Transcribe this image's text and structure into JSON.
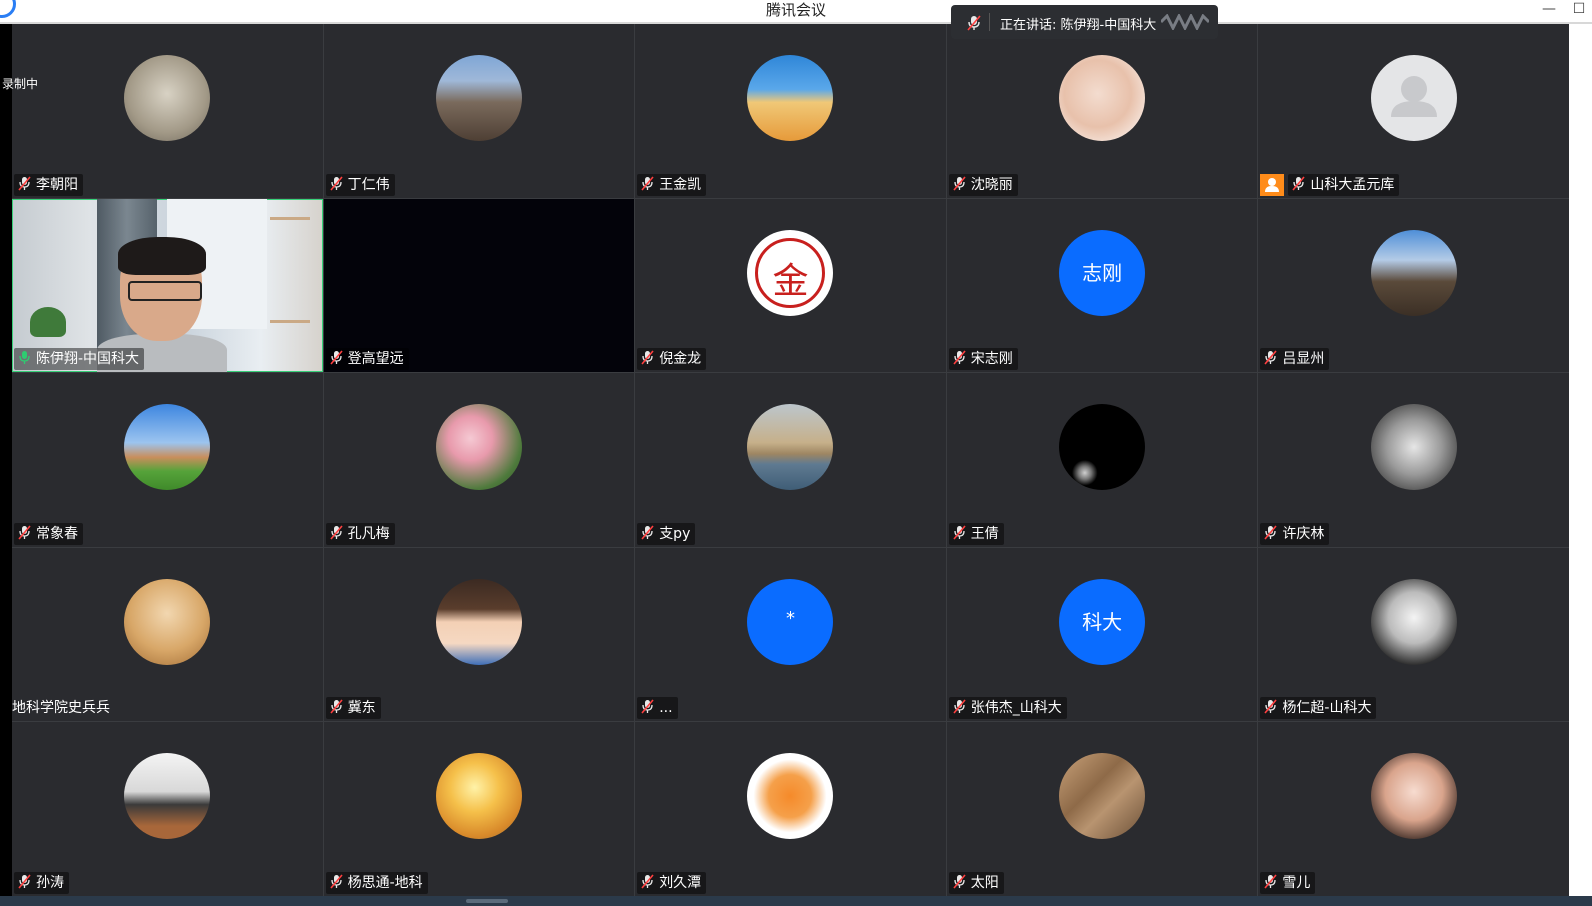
{
  "app": {
    "title": "腾讯会议",
    "recording_label": "录制中"
  },
  "speaking_banner": {
    "text": "正在讲话: 陈伊翔-中国科大"
  },
  "colors": {
    "accent_blue": "#0a6cff",
    "host_badge": "#ff8c1a",
    "speaking_green": "#39d17a",
    "tile_bg": "#2a2b2f"
  },
  "participants": [
    {
      "name": "李朝阳",
      "avatar": "smile-photo",
      "mic": "muted"
    },
    {
      "name": "丁仁伟",
      "avatar": "rock-photo",
      "mic": "muted"
    },
    {
      "name": "王金凯",
      "avatar": "desert-photo",
      "mic": "muted"
    },
    {
      "name": "沈晓丽",
      "avatar": "portrait-photo",
      "mic": "muted"
    },
    {
      "name": "山科大孟元库",
      "avatar": "default-user",
      "mic": "muted",
      "host": true
    },
    {
      "name": "陈伊翔-中国科大",
      "avatar": "camera-video",
      "mic": "speaking"
    },
    {
      "name": "登高望远",
      "avatar": "video-black",
      "mic": "muted"
    },
    {
      "name": "倪金龙",
      "avatar": "gold-logo",
      "mic": "muted",
      "avatar_text": "金"
    },
    {
      "name": "宋志刚",
      "avatar": "text",
      "avatar_text": "志刚",
      "mic": "muted"
    },
    {
      "name": "吕显州",
      "avatar": "landscape-photo",
      "mic": "muted"
    },
    {
      "name": "常象春",
      "avatar": "house-photo",
      "mic": "muted"
    },
    {
      "name": "孔凡梅",
      "avatar": "flowers-photo",
      "mic": "muted"
    },
    {
      "name": "支py",
      "avatar": "sea-photo",
      "mic": "muted"
    },
    {
      "name": "王倩",
      "avatar": "moon-photo",
      "mic": "muted"
    },
    {
      "name": "许庆林",
      "avatar": "bw-portrait",
      "mic": "muted"
    },
    {
      "name": "地科学院史兵兵",
      "avatar": "dog-photo",
      "mic": "none"
    },
    {
      "name": "冀东",
      "avatar": "anime-photo",
      "mic": "muted"
    },
    {
      "name": "...",
      "avatar": "text",
      "avatar_text": "*",
      "mic": "muted"
    },
    {
      "name": "张伟杰_山科大",
      "avatar": "text",
      "avatar_text": "科大",
      "mic": "muted"
    },
    {
      "name": "杨仁超-山科大",
      "avatar": "panda-photo",
      "mic": "muted"
    },
    {
      "name": "孙涛",
      "avatar": "penguins-photo",
      "mic": "muted"
    },
    {
      "name": "杨思通-地科",
      "avatar": "sunrise-photo",
      "mic": "muted"
    },
    {
      "name": "刘久潭",
      "avatar": "tiger-cartoon",
      "mic": "muted"
    },
    {
      "name": "太阳",
      "avatar": "rock-texture",
      "mic": "muted"
    },
    {
      "name": "雪儿",
      "avatar": "girl-portrait",
      "mic": "muted"
    }
  ]
}
